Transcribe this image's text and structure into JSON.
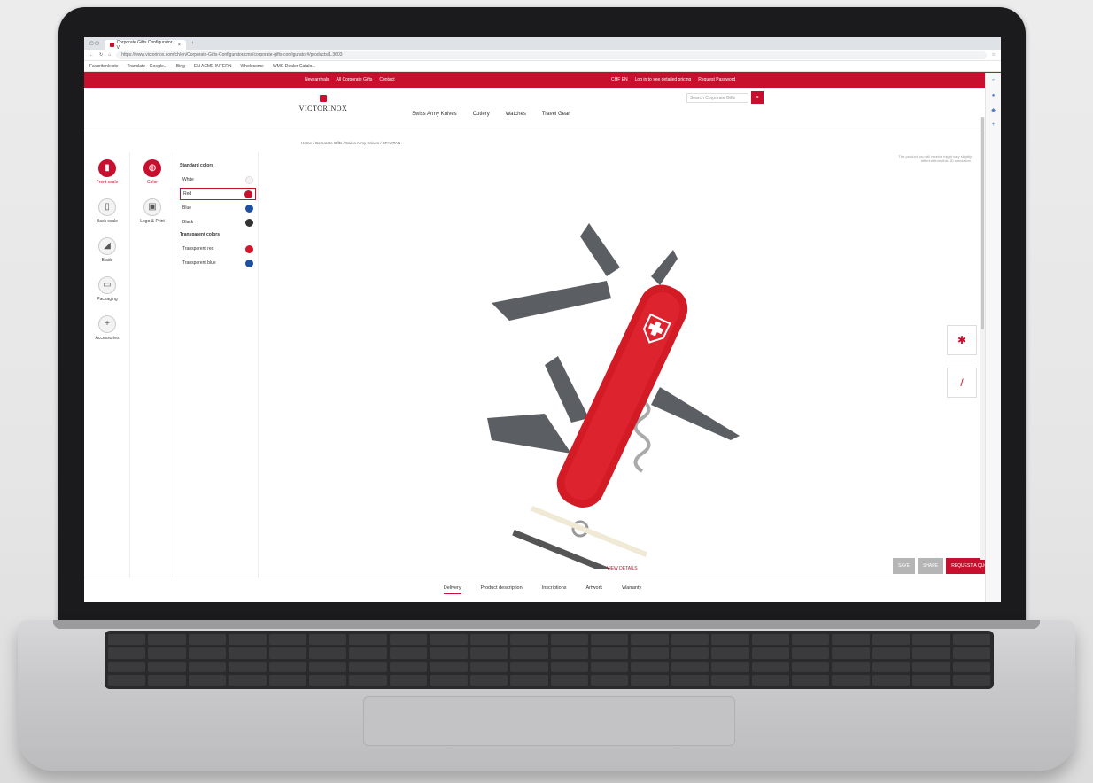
{
  "browser": {
    "tab_title": "Corporate Gifts Configurator | V",
    "url": "https://www.victorinox.com/ch/en/Corporate-Gifts-Configurator/cms/corporate-gifts-configurator#/products/1.3603",
    "bookmarks": [
      "Favoritenleiste",
      "Translate - Google...",
      "Bing",
      "EN ACME INTERN",
      "Wholesome",
      "WMC Dealer Catalo..."
    ]
  },
  "site": {
    "topbar": {
      "links": [
        "New arrivals",
        "All Corporate Gifts",
        "Contact"
      ],
      "currency": "CHF EN",
      "login": "Log in to see detailed pricing",
      "request_password": "Request Password"
    },
    "logo_text": "VICTORINOX",
    "search_placeholder": "Search Corporate Gifts",
    "nav": [
      "Swiss Army Knives",
      "Cutlery",
      "Watches",
      "Travel Gear"
    ],
    "breadcrumb": "Home / Corporate Gifts / Swiss Army Knives / SPARTAN"
  },
  "config": {
    "rail": [
      {
        "label": "Front scale",
        "icon": "knife-front-icon",
        "active": true
      },
      {
        "label": "Back scale",
        "icon": "knife-back-icon",
        "active": false
      },
      {
        "label": "Blade",
        "icon": "blade-icon",
        "active": false
      },
      {
        "label": "Packaging",
        "icon": "packaging-icon",
        "active": false
      },
      {
        "label": "Accessories",
        "icon": "plus-icon",
        "active": false
      }
    ],
    "rail2": [
      {
        "label": "Color",
        "active": true
      },
      {
        "label": "Logo & Print",
        "active": false
      }
    ],
    "standard_heading": "Standard colors",
    "standard_colors": [
      {
        "name": "White",
        "color": "#f6f2f2",
        "selected": false
      },
      {
        "name": "Red",
        "color": "#c8102e",
        "selected": true
      },
      {
        "name": "Blue",
        "color": "#1f4fa0",
        "selected": false
      },
      {
        "name": "Black",
        "color": "#333333",
        "selected": false
      }
    ],
    "transparent_heading": "Transparent colors",
    "transparent_colors": [
      {
        "name": "Transparent red",
        "color": "#d4152c"
      },
      {
        "name": "Transparent blue",
        "color": "#1f4fa0"
      }
    ],
    "note": "The product you will receive might vary slightly different from this 3D simulation.",
    "view_details": "VIEW DETAILS",
    "actions": {
      "save": "SAVE",
      "share": "SHARE",
      "quote": "REQUEST A QUOTE"
    }
  },
  "bottom_tabs": [
    "Delivery",
    "Product description",
    "Inscriptions",
    "Artwork",
    "Warranty"
  ],
  "colors": {
    "brand_red": "#c8102e"
  }
}
